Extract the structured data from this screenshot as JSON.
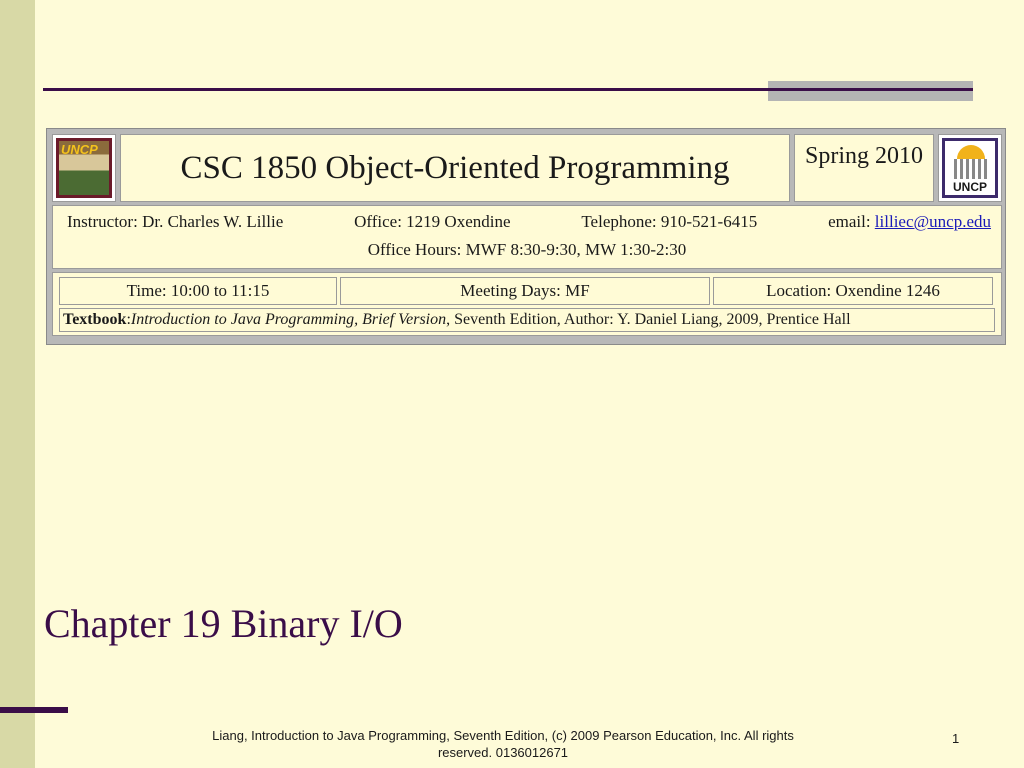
{
  "banner": {
    "logo_left_text": "UNCP",
    "title": "CSC 1850 Object-Oriented Programming",
    "term": "Spring 2010",
    "logo_right_text": "UNCP",
    "instructor": "Instructor: Dr. Charles W. Lillie",
    "office": "Office: 1219 Oxendine",
    "telephone": "Telephone: 910-521-6415",
    "email_label": "email: ",
    "email": "lilliec@uncp.edu",
    "office_hours": "Office Hours: MWF 8:30-9:30, MW 1:30-2:30",
    "time": "Time: 10:00 to 11:15",
    "meeting_days": "Meeting Days: MF",
    "location": "Location: Oxendine 1246",
    "textbook_label": "Textbook",
    "textbook_sep": ": ",
    "textbook_title": "Introduction to Java Programming, Brief Version",
    "textbook_rest": ", Seventh Edition, Author: Y. Daniel Liang, 2009, Prentice Hall"
  },
  "slide": {
    "title": "Chapter 19 Binary I/O",
    "footer": "Liang, Introduction to Java Programming, Seventh Edition, (c) 2009 Pearson Education, Inc. All rights reserved. 0136012671",
    "page_number": "1"
  },
  "colors": {
    "background": "#fefbd8",
    "left_bar": "#d8d9a6",
    "accent": "#3a0d48"
  }
}
